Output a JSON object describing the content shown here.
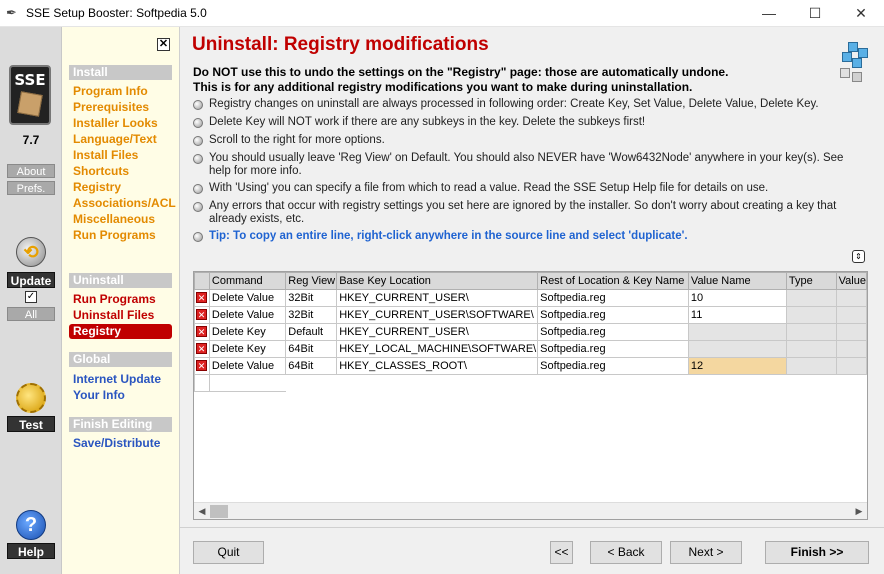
{
  "window": {
    "title": "SSE Setup Booster: Softpedia 5.0",
    "minimize": "—",
    "maximize": "☐",
    "close": "✕"
  },
  "leftbar": {
    "logo": "SSE",
    "version": "7.7",
    "about": "About",
    "prefs": "Prefs.",
    "update": "Update",
    "all": "All",
    "test": "Test",
    "help": "Help"
  },
  "nav": {
    "close": "✕",
    "install_head": "Install",
    "install_items": [
      "Program Info",
      "Prerequisites",
      "Installer Looks",
      "Language/Text",
      "Install Files",
      "Shortcuts",
      "Registry",
      "Associations/ACL",
      "Miscellaneous",
      "Run Programs"
    ],
    "uninstall_head": "Uninstall",
    "uninstall_items": [
      "Run Programs",
      "Uninstall Files",
      "Registry"
    ],
    "global_head": "Global",
    "global_items": [
      "Internet Update",
      "Your Info"
    ],
    "finish_head": "Finish Editing",
    "finish_items": [
      "Save/Distribute"
    ]
  },
  "main": {
    "title": "Uninstall: Registry modifications",
    "warn1": "Do NOT use this to undo the settings on the \"Registry\" page: those are automatically undone.",
    "warn2": "This is for any additional registry modifications you want to make during uninstallation.",
    "bullets": [
      "Registry changes on uninstall are always processed in following order: Create Key, Set Value, Delete Value, Delete Key.",
      "Delete Key will NOT work if there are any subkeys in the key. Delete the subkeys first!",
      "Scroll to the right for more options.",
      "You should usually leave 'Reg View' on Default. You should also NEVER have 'Wow6432Node' anywhere in your key(s). See help for more info.",
      "With 'Using' you can specify a file from which to read a value. Read the SSE Setup Help file for details on use.",
      "Any errors that occur with registry settings you set here are ignored by the installer. So don't worry about creating a key that already exists, etc."
    ],
    "tip": "Tip: To copy an entire line, right-click anywhere in the source line and select 'duplicate'."
  },
  "grid": {
    "headers": [
      "Command",
      "Reg View",
      "Base Key Location",
      "Rest of Location & Key Name",
      "Value Name",
      "Type",
      "Value"
    ],
    "rows": [
      [
        "Delete Value",
        "32Bit",
        "HKEY_CURRENT_USER\\",
        "Softpedia.reg",
        "10"
      ],
      [
        "Delete Value",
        "32Bit",
        "HKEY_CURRENT_USER\\SOFTWARE\\",
        "Softpedia.reg",
        "11"
      ],
      [
        "Delete Key",
        "Default",
        "HKEY_CURRENT_USER\\",
        "Softpedia.reg",
        ""
      ],
      [
        "Delete Key",
        "64Bit",
        "HKEY_LOCAL_MACHINE\\SOFTWARE\\",
        "Softpedia.reg",
        ""
      ],
      [
        "Delete Value",
        "64Bit",
        "HKEY_CLASSES_ROOT\\",
        "Softpedia.reg",
        "12"
      ]
    ]
  },
  "buttons": {
    "quit": "Quit",
    "first": "<<",
    "back": "< Back",
    "next": "Next >",
    "finish": "Finish >>"
  }
}
